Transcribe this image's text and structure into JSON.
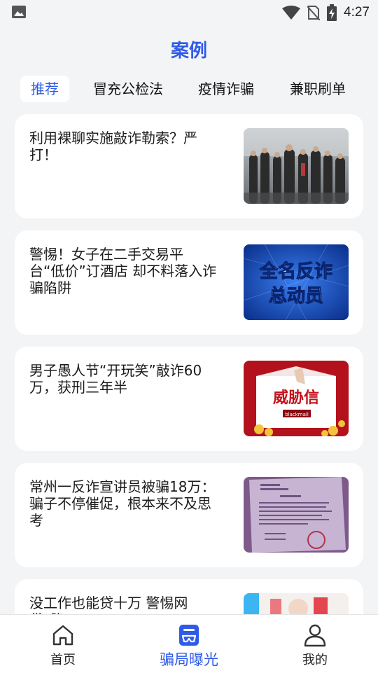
{
  "status_bar": {
    "time": "4:27"
  },
  "page": {
    "title": "案例"
  },
  "tabs": [
    {
      "label": "推荐",
      "active": true
    },
    {
      "label": "冒充公检法",
      "active": false
    },
    {
      "label": "疫情诈骗",
      "active": false
    },
    {
      "label": "兼职刷单",
      "active": false
    }
  ],
  "articles": [
    {
      "title": "利用裸聊实施敲诈勒索？严打！",
      "thumb": "crowd-rain-photo"
    },
    {
      "title": "警惕！女子在二手交易平台“低价”订酒店 却不料落入诈骗陷阱",
      "thumb": "anti-fraud-poster",
      "thumb_text_1": "全名反诈",
      "thumb_text_2": "总动员"
    },
    {
      "title": "男子愚人节“开玩笑”敲诈60万，获刑三年半",
      "thumb": "threat-letter-illustration",
      "thumb_text_1": "威胁信",
      "thumb_text_2": "blackmail"
    },
    {
      "title": "常州一反诈宣讲员被骗18万：骗子不停催促，根本来不及思考",
      "thumb": "document-photo"
    },
    {
      "title": "没工作也能贷十万 警惕网贷“隐",
      "thumb": "cartoon-illustration"
    }
  ],
  "bottom_nav": [
    {
      "label": "首页",
      "icon": "home-icon",
      "active": false
    },
    {
      "label": "骗局曝光",
      "icon": "exposure-icon",
      "active": true
    },
    {
      "label": "我的",
      "icon": "profile-icon",
      "active": false
    }
  ],
  "colors": {
    "accent": "#2f5be8",
    "background": "#f3f4f6",
    "card": "#ffffff"
  }
}
